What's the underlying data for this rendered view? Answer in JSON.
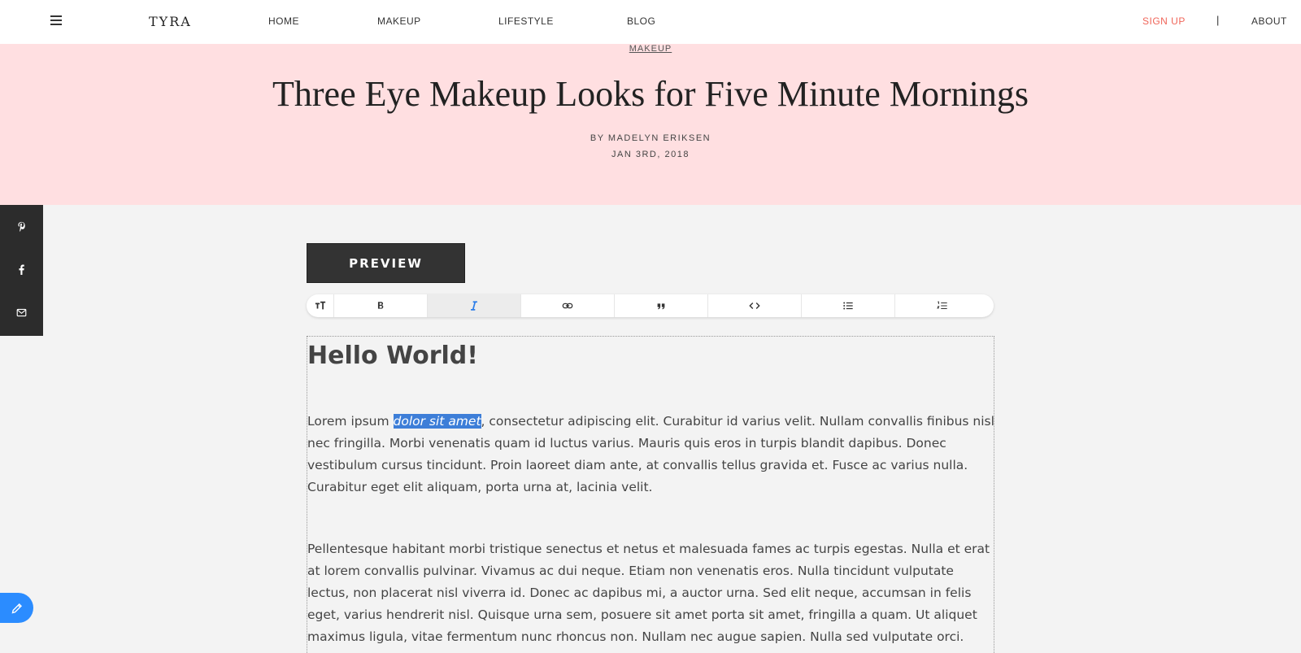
{
  "nav": {
    "logo": "TYRA",
    "links": [
      "HOME",
      "MAKEUP",
      "LIFESTYLE",
      "BLOG"
    ],
    "signup": "SIGN UP",
    "separator": "|",
    "about": "ABOUT"
  },
  "hero": {
    "category": "MAKEUP",
    "title": "Three Eye Makeup Looks for Five Minute Mornings",
    "byline": "BY MADELYN ERIKSEN",
    "date": "JAN 3RD, 2018"
  },
  "share": [
    "pinterest-icon",
    "facebook-icon",
    "mail-icon"
  ],
  "editor": {
    "preview_label": "PREVIEW",
    "toolbar": [
      "text-size-icon",
      "bold-icon",
      "italic-icon",
      "link-icon",
      "quote-icon",
      "code-icon",
      "bullet-list-icon",
      "numbered-list-icon"
    ],
    "active_tool": "italic-icon",
    "heading": "Hello World!",
    "p1_before": "Lorem ipsum ",
    "p1_selected": "dolor sit amet",
    "p1_after": ", consectetur adipiscing elit. Curabitur id varius velit. Nullam convallis finibus nisl nec fringilla. Morbi venenatis quam id luctus varius. Mauris quis eros in turpis blandit dapibus. Donec vestibulum cursus tincidunt. Proin laoreet diam ante, at convallis tellus gravida et. Fusce ac varius nulla. Curabitur eget elit aliquam, porta urna at, lacinia velit.",
    "p2": "Pellentesque habitant morbi tristique senectus et netus et malesuada fames ac turpis egestas. Nulla et erat at lorem convallis pulvinar. Vivamus ac dui neque. Etiam non venenatis eros. Nulla tincidunt vulputate lectus, non placerat nisl viverra id. Donec ac dapibus mi, a auctor urna. Sed elit neque, accumsan in felis eget, varius hendrerit nisl. Quisque urna sem, posuere sit amet porta sit amet, fringilla a quam. Ut aliquet maximus ligula, vitae fermentum nunc rhoncus non. Nullam nec augue sapien. Nulla sed vulputate orci. Vivamus ipsum ipsum,"
  },
  "colors": {
    "accent": "#f0665a",
    "hero_bg": "#ffdfe1",
    "selection": "#3d7ed8",
    "fab": "#2b8cff"
  }
}
